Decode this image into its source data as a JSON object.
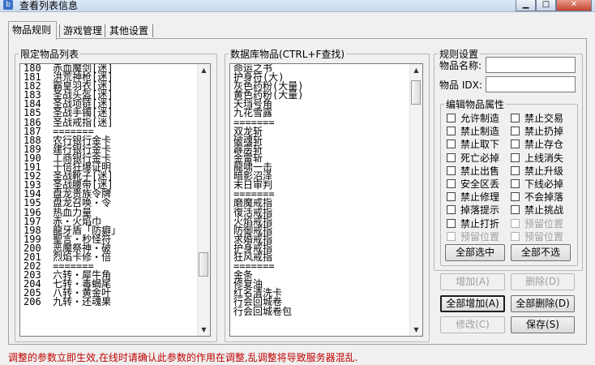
{
  "window": {
    "title": "查看列表信息"
  },
  "tabs": [
    {
      "label": "物品规则",
      "active": true
    },
    {
      "label": "游戏管理",
      "active": false
    },
    {
      "label": "其他设置",
      "active": false
    }
  ],
  "limited_items": {
    "title": "限定物品列表",
    "items": [
      "180  赤血魔剑[迷]",
      "181  洪荒神枪[迷]",
      "182  霸皇羽衣[迷]",
      "183  圣战头盔[迷]",
      "184  圣战项链[迷]",
      "185  圣战手镯[迷]",
      "186  圣战戒指[迷]",
      "187  =======",
      "188  农行银行金卡",
      "189  建行银行金卡",
      "190  工商银行金卡",
      "191  十倍狂爆证明",
      "192  圣战靴子[迷]",
      "193  圣战腰带[迷]",
      "194  盘龙贵族令牌",
      "195  盘龙召唤・令",
      "196  热血力量",
      "197  赤・火焰巾",
      "198  龍牙盾「防癖」",
      "199  聖言・秒怪符",
      "200  恶魔祭神・破",
      "201  烈焰卡修・倍",
      "202  =======",
      "203  六转・犀牛角",
      "204  七转・毒蝎尾",
      "205  八转・黄金叶",
      "206  九转・还魂果"
    ]
  },
  "db_items": {
    "title": "数据库物品(CTRL+F查找)",
    "items": [
      "命运之书",
      "护身符(大)",
      "灰色药粉(大量)",
      "黄色药粉(大量)",
      "天珰号角",
      "九花雪露",
      "=======",
      "双龙斩",
      "破魂斩",
      "霹雳斩",
      "金雷斩",
      "龍啸一击",
      "暗影沼泽",
      "末日审判",
      "=======",
      "磨魔戒指",
      "復活戒指",
      "火焰戒指",
      "防御戒指",
      "求婚戒指",
      "护身戒指",
      "狂风戒指",
      "=======",
      "金条",
      "修复油",
      "红名清洗卡",
      "行会回城卷",
      "行会回城卷包"
    ]
  },
  "rules": {
    "title": "规则设置",
    "name_label": "物品名称:",
    "name_value": "",
    "idx_label": "物品 IDX:",
    "idx_value": "",
    "attr_title": "编辑物品属性",
    "attributes": [
      {
        "label": "允许制造",
        "disabled": false
      },
      {
        "label": "禁止交易",
        "disabled": false
      },
      {
        "label": "禁止制造",
        "disabled": false
      },
      {
        "label": "禁止扔掉",
        "disabled": false
      },
      {
        "label": "禁止取下",
        "disabled": false
      },
      {
        "label": "禁止存仓",
        "disabled": false
      },
      {
        "label": "死亡必掉",
        "disabled": false
      },
      {
        "label": "上线消失",
        "disabled": false
      },
      {
        "label": "禁止出售",
        "disabled": false
      },
      {
        "label": "禁止升级",
        "disabled": false
      },
      {
        "label": "安全区丢",
        "disabled": false
      },
      {
        "label": "下线必掉",
        "disabled": false
      },
      {
        "label": "禁止修理",
        "disabled": false
      },
      {
        "label": "不会掉落",
        "disabled": false
      },
      {
        "label": "掉落提示",
        "disabled": false
      },
      {
        "label": "禁止挑战",
        "disabled": false
      },
      {
        "label": "禁止打折",
        "disabled": false
      },
      {
        "label": "预留位置",
        "disabled": true
      },
      {
        "label": "预留位置",
        "disabled": true
      },
      {
        "label": "预留位置",
        "disabled": true
      }
    ],
    "select_all": "全部选中",
    "select_none": "全部不选"
  },
  "actions": {
    "add": "增加(A)",
    "delete": "删除(D)",
    "add_all": "全部增加(A)",
    "delete_all": "全部删除(D)",
    "modify": "修改(C)",
    "save": "保存(S)"
  },
  "status_text": "调整的参数立即生效,在线时请确认此参数的作用在调整,乱调整将导致服务器混乱."
}
